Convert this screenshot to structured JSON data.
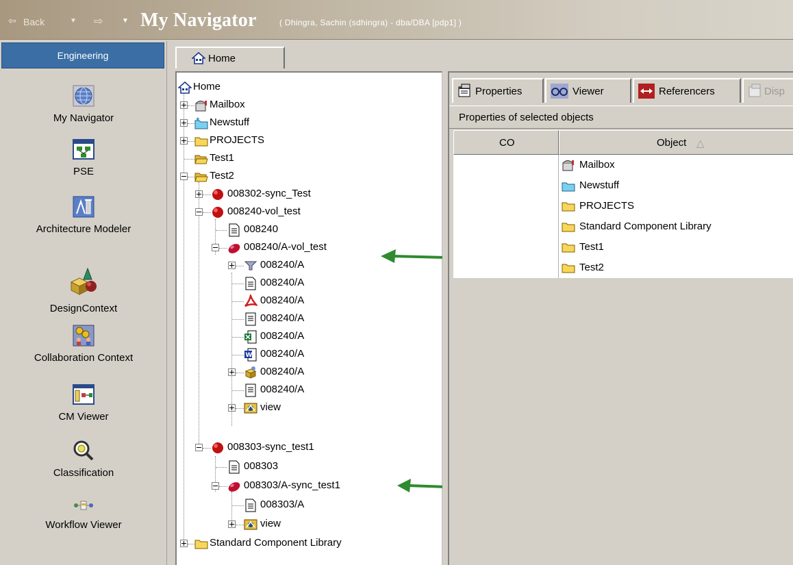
{
  "titlebar": {
    "back_label": "Back",
    "title": "My Navigator",
    "subtitle": "( Dhingra, Sachin (sdhingra) - dba/DBA  [pdp1] )"
  },
  "leftnav": {
    "header": "Engineering",
    "items": [
      {
        "label": "My Navigator",
        "icon": "globe-icon"
      },
      {
        "label": "PSE",
        "icon": "product-structure-icon"
      },
      {
        "label": "Architecture Modeler",
        "icon": "architecture-modeler-icon"
      },
      {
        "label": "DesignContext",
        "icon": "design-context-icon"
      },
      {
        "label": "Collaboration Context",
        "icon": "collaboration-icon"
      },
      {
        "label": "CM Viewer",
        "icon": "cm-viewer-icon"
      },
      {
        "label": "Classification",
        "icon": "magnifier-icon"
      },
      {
        "label": "Workflow Viewer",
        "icon": "workflow-icon"
      }
    ]
  },
  "main_tab": {
    "label": "Home"
  },
  "tree": {
    "nodes": [
      {
        "label": "Home"
      },
      {
        "label": "Mailbox"
      },
      {
        "label": "Newstuff"
      },
      {
        "label": "PROJECTS"
      },
      {
        "label": "Test1"
      },
      {
        "label": "Test2"
      },
      {
        "label": "008302-sync_Test"
      },
      {
        "label": "008240-vol_test"
      },
      {
        "label": "008240"
      },
      {
        "label": "008240/A-vol_test"
      },
      {
        "label": "008240/A"
      },
      {
        "label": "008240/A"
      },
      {
        "label": "008240/A"
      },
      {
        "label": "008240/A"
      },
      {
        "label": "008240/A"
      },
      {
        "label": "008240/A"
      },
      {
        "label": "008240/A"
      },
      {
        "label": "008240/A"
      },
      {
        "label": "view"
      },
      {
        "label": "008303-sync_test1"
      },
      {
        "label": "008303"
      },
      {
        "label": "008303/A-sync_test1"
      },
      {
        "label": "008303/A"
      },
      {
        "label": "view"
      },
      {
        "label": "Standard Component Library"
      }
    ]
  },
  "right_tabs": [
    {
      "label": "Properties",
      "icon": "properties-icon"
    },
    {
      "label": "Viewer",
      "icon": "glasses-icon"
    },
    {
      "label": "Referencers",
      "icon": "referencers-icon"
    },
    {
      "label": "Disp",
      "icon": "display-icon"
    }
  ],
  "properties": {
    "header": "Properties of selected objects",
    "columns": [
      "CO",
      "Object"
    ],
    "sort_indicator": "△",
    "rows": [
      {
        "co": "",
        "object": "Mailbox",
        "icon": "mailbox-icon"
      },
      {
        "co": "",
        "object": "Newstuff",
        "icon": "newstuff-folder-icon"
      },
      {
        "co": "",
        "object": "PROJECTS",
        "icon": "folder-icon"
      },
      {
        "co": "",
        "object": "Standard Component Library",
        "icon": "folder-icon"
      },
      {
        "co": "",
        "object": "Test1",
        "icon": "folder-icon"
      },
      {
        "co": "",
        "object": "Test2",
        "icon": "folder-icon"
      }
    ]
  },
  "colors": {
    "header_blue": "#3a6ea5",
    "arrow_green": "#2e8b2e",
    "folder_yellow": "#f7d65a"
  }
}
